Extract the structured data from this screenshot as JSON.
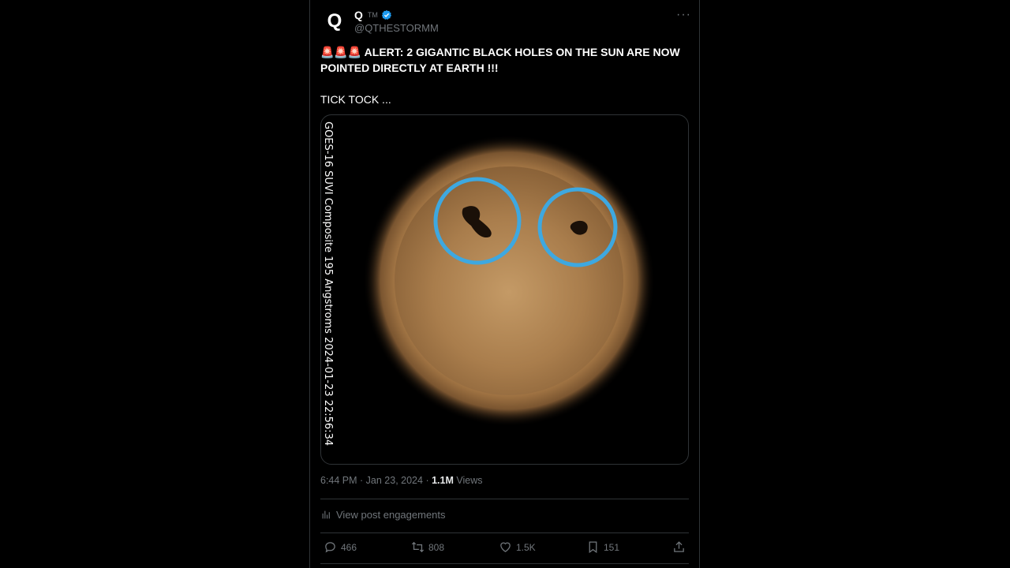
{
  "author": {
    "avatar_letter": "Q",
    "name": "Q",
    "name_suffix": "TM",
    "handle": "@QTHESTORMM",
    "verified_icon": "verified-badge-icon"
  },
  "more_label": "···",
  "tweet": {
    "sirens": "🚨🚨🚨",
    "headline": "ALERT: 2 GIGANTIC BLACK HOLES ON THE SUN ARE NOW POINTED DIRECTLY AT EARTH !!!",
    "line2": "TICK TOCK ..."
  },
  "media": {
    "side_label": "GOES-16 SUVI Composite 195 Angstroms 2024-01-23 22:56:34",
    "circle_color": "#3ea8e0",
    "sun_color": "#a87c4c"
  },
  "meta": {
    "time": "6:44 PM",
    "sep1": " · ",
    "date": "Jan 23, 2024",
    "sep2": " · ",
    "views_count": "1.1M",
    "views_label": " Views"
  },
  "engagements_label": "View post engagements",
  "actions": {
    "replies": "466",
    "reposts": "808",
    "likes": "1.5K",
    "bookmarks": "151"
  }
}
